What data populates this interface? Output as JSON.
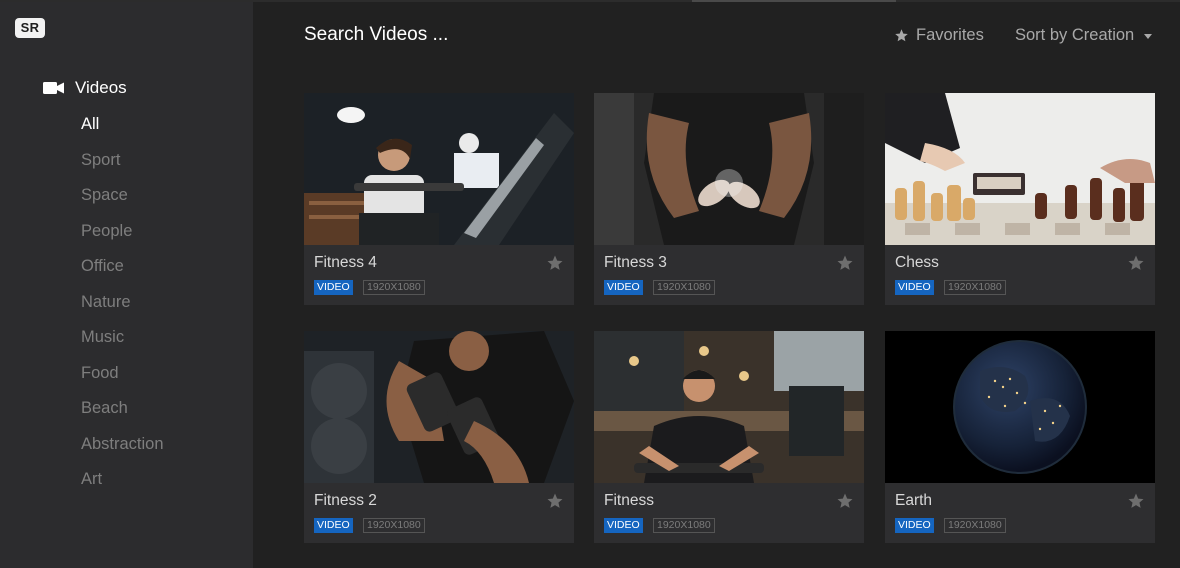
{
  "app": {
    "logo": "SR"
  },
  "sidebar": {
    "section_label": "Videos",
    "section_icon": "video-camera-icon",
    "categories": [
      "All",
      "Sport",
      "Space",
      "People",
      "Office",
      "Nature",
      "Music",
      "Food",
      "Beach",
      "Abstraction",
      "Art"
    ],
    "active_category": "All"
  },
  "header": {
    "search_placeholder": "Search Videos ...",
    "favorites_label": "Favorites",
    "sort_label": "Sort by Creation"
  },
  "colors": {
    "sidebar_bg": "#2c2c2e",
    "main_bg": "#212121",
    "card_bg": "#2e2e30",
    "badge_blue": "#1565c0"
  },
  "cards": [
    {
      "title": "Fitness 4",
      "type": "VIDEO",
      "resolution": "1920X1080",
      "thumbnail": "woman-rowing-machine-gym"
    },
    {
      "title": "Fitness 3",
      "type": "VIDEO",
      "resolution": "1920X1080",
      "thumbnail": "man-clapping-chalk-hands"
    },
    {
      "title": "Chess",
      "type": "VIDEO",
      "resolution": "1920X1080",
      "thumbnail": "chess-pieces-on-board"
    },
    {
      "title": "Fitness 2",
      "type": "VIDEO",
      "resolution": "1920X1080",
      "thumbnail": "man-lifting-dumbbell"
    },
    {
      "title": "Fitness",
      "type": "VIDEO",
      "resolution": "1920X1080",
      "thumbnail": "man-on-rowing-machine-gym"
    },
    {
      "title": "Earth",
      "type": "VIDEO",
      "resolution": "1920X1080",
      "thumbnail": "earth-at-night-from-space"
    }
  ]
}
